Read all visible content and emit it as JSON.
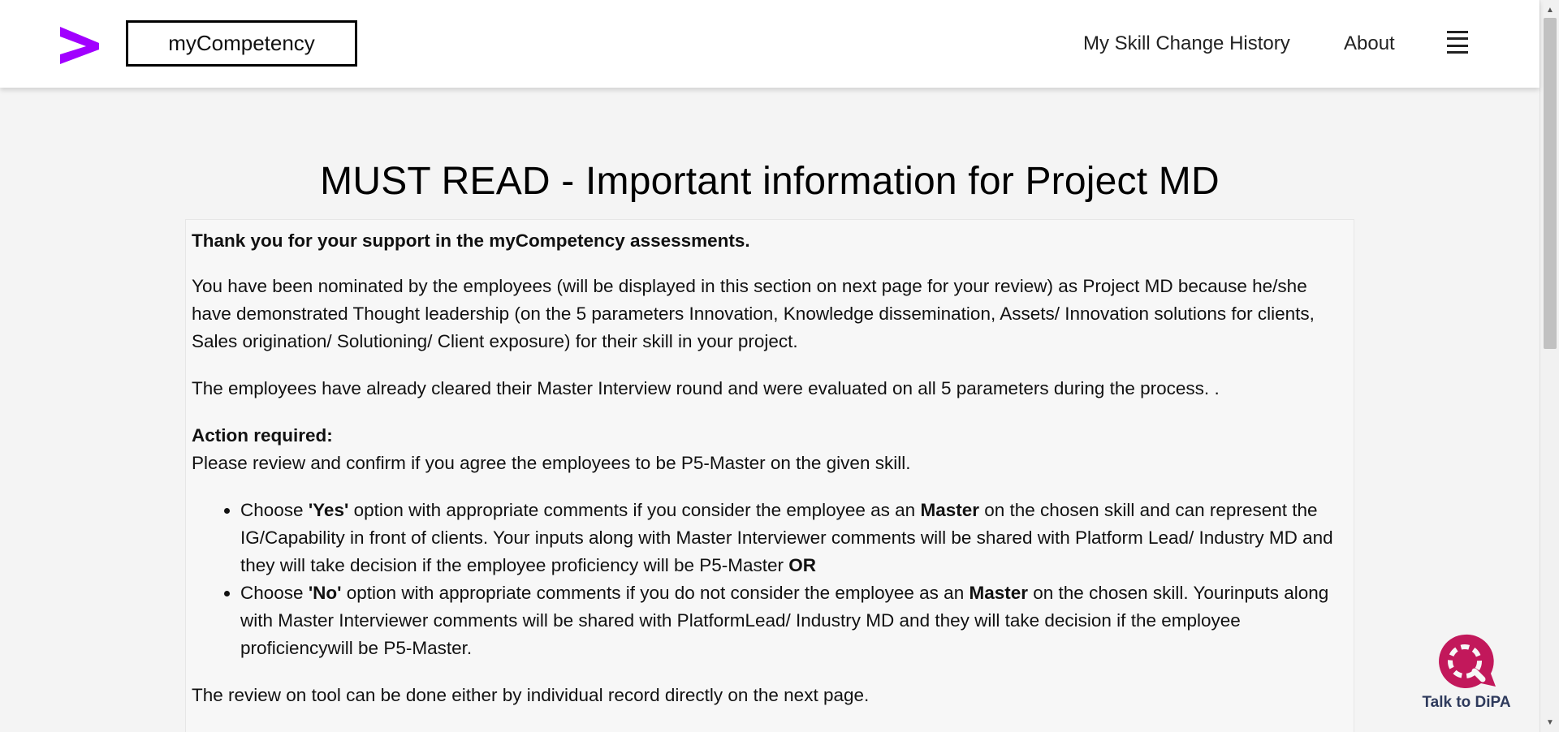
{
  "header": {
    "brand": "myCompetency",
    "nav": {
      "history": "My Skill Change History",
      "about": "About"
    },
    "logo_color": "#a100ff"
  },
  "main": {
    "title": "MUST READ - Important information for Project MD",
    "thanks": "Thank you for your support in the myCompetency assessments.",
    "para1": "You have been nominated by the employees (will be displayed in this section on next page for your review) as Project MD because he/she have demonstrated Thought leadership (on the 5 parameters Innovation, Knowledge dissemination, Assets/ Innovation solutions for clients, Sales origination/ Solutioning/ Client exposure) for their skill in your project.",
    "para2": "The employees have already cleared their Master Interview round and were evaluated on all 5 parameters during the process. .",
    "action_heading": "Action required:",
    "action_text": "Please review and confirm if you agree the employees to be P5-Master on the given skill.",
    "bullet1": {
      "pre": "Choose ",
      "option": "'Yes'",
      "mid": " option with appropriate comments if you consider the employee as an ",
      "master": "Master",
      "post": " on the chosen skill and can represent the IG/Capability in front of clients. Your inputs along with Master Interviewer comments will be shared with Platform Lead/ Industry MD and they will take decision if the employee proficiency will be P5-Master ",
      "or": "OR"
    },
    "bullet2": {
      "pre": "Choose ",
      "option": "'No'",
      "mid": " option with appropriate comments if you do not consider the employee as an ",
      "master": "Master",
      "post": " on the chosen skill. Yourinputs along with Master Interviewer comments will be shared with PlatformLead/ Industry MD and they will take decision if the employee proficiencywill be P5-Master."
    },
    "para3": "The review on tool can be done either by individual record directly on the next page."
  },
  "dipa": {
    "label": "Talk to DiPA",
    "color": "#c2185b"
  }
}
